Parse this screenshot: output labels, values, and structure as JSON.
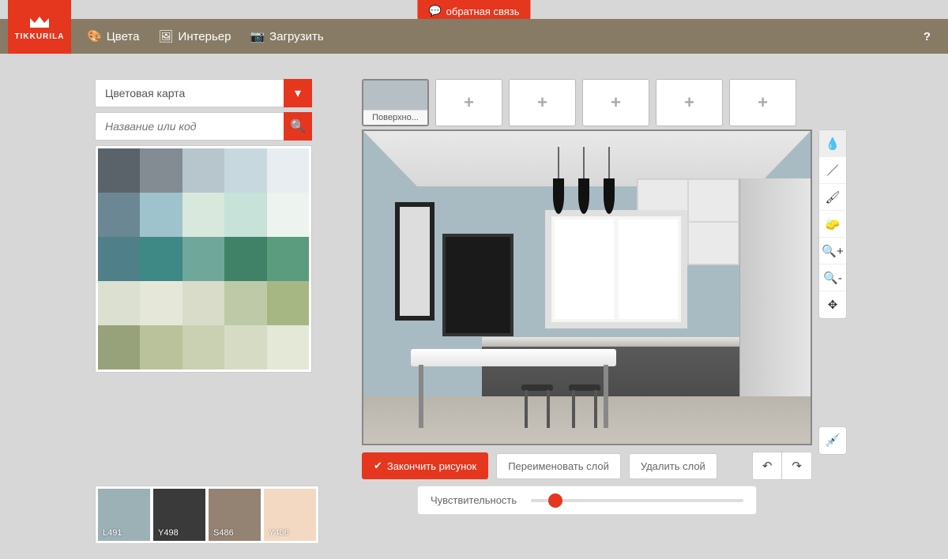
{
  "feedback": {
    "label": "обратная связь"
  },
  "brand": "TIKKURILA",
  "nav": {
    "colors": "Цвета",
    "interior": "Интерьер",
    "upload": "Загрузить"
  },
  "sidebar": {
    "dropdown_label": "Цветовая карта",
    "search_placeholder": "Название или код",
    "palette": [
      "#5a636a",
      "#828c92",
      "#b7c6cc",
      "#c7d9df",
      "#e7edf0",
      "#6b8793",
      "#9fc3cc",
      "#d8e8dc",
      "#c6e2d9",
      "#edf4ef",
      "#4f8089",
      "#3e8886",
      "#6fa79b",
      "#3f8268",
      "#5a9c7d",
      "#dbe0d0",
      "#e5e8d9",
      "#d9dcc9",
      "#becaa7",
      "#a7b783",
      "#98a27a",
      "#b9c29a",
      "#c9d1b2",
      "#d6dcc4",
      "#e4e8d6"
    ]
  },
  "surfaces": {
    "active_label": "Поверхно..."
  },
  "tools": [
    "fill",
    "line",
    "brush",
    "eraser",
    "zoom-in",
    "zoom-out",
    "move"
  ],
  "actions": {
    "finish": "Закончить рисунок",
    "rename": "Переименовать слой",
    "delete": "Удалить слой"
  },
  "sensitivity": {
    "label": "Чувствительность",
    "value": 8
  },
  "selected": [
    {
      "code": "L491",
      "hex": "#9bb1b6"
    },
    {
      "code": "Y498",
      "hex": "#3a3a3a"
    },
    {
      "code": "S486",
      "hex": "#948372"
    },
    {
      "code": "Y406",
      "hex": "#f3d9c2"
    }
  ]
}
